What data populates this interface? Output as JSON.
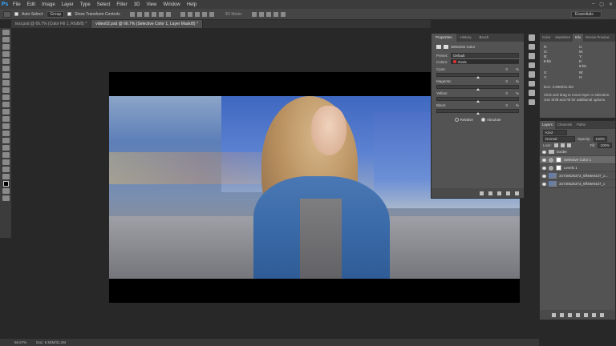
{
  "app": {
    "logo": "Ps"
  },
  "menu": [
    "File",
    "Edit",
    "Image",
    "Layer",
    "Type",
    "Select",
    "Filter",
    "3D",
    "View",
    "Window",
    "Help"
  ],
  "window_controls": [
    "–",
    "▢",
    "✕"
  ],
  "options_bar": {
    "auto_select_label": "Auto-Select:",
    "auto_select_value": "Group",
    "show_transform_label": "Show Transform Controls",
    "mode_label": "3D Mode:",
    "workspace": "Essentials"
  },
  "tabs": [
    {
      "label": "test.psd @ 66.7% (Color Fill 1, RGB/8) *",
      "active": false
    },
    {
      "label": "video02.psd @ 66.7% (Selective Color 1, Layer Mask/8) *",
      "active": true
    }
  ],
  "properties_panel": {
    "tabs": [
      "Properties",
      "History",
      "Brush"
    ],
    "title": "Selective Color",
    "preset_label": "Preset:",
    "preset_value": "Default",
    "colors_label": "Colors:",
    "colors_value": "Reds",
    "sliders": [
      {
        "label": "Cyan:",
        "value": "0",
        "unit": "%",
        "position": 0.5
      },
      {
        "label": "Magenta:",
        "value": "0",
        "unit": "%",
        "position": 0.5
      },
      {
        "label": "Yellow:",
        "value": "0",
        "unit": "%",
        "position": 0.5
      },
      {
        "label": "Black:",
        "value": "0",
        "unit": "%",
        "position": 0.5
      }
    ],
    "method_relative": "Relative",
    "method_absolute": "Absolute",
    "method_selected": "Absolute"
  },
  "info_panel": {
    "tabs": [
      "Color",
      "Swatches",
      "Info",
      "Device Preview"
    ],
    "left": [
      "R:",
      "G:",
      "B:",
      "8-bit"
    ],
    "right": [
      "C:",
      "M:",
      "Y:",
      "K:",
      "8-bit"
    ],
    "xy": [
      "X:",
      "Y:"
    ],
    "wh": [
      "W:",
      "H:"
    ],
    "doc": "Doc: 3.95M/31.2M",
    "hint": "Click and drag to move layer or selection. Use Shift and Alt for additional options."
  },
  "layers_panel": {
    "tabs": [
      "Layers",
      "Channels",
      "Paths"
    ],
    "filter_value": "Kind",
    "blend_mode": "Normal",
    "opacity_label": "Opacity:",
    "opacity_value": "100%",
    "lock_label": "Lock:",
    "fill_label": "Fill:",
    "fill_value": "100%",
    "layers": [
      {
        "name": "border",
        "kind": "group",
        "selected": false
      },
      {
        "name": "Selective Color 1",
        "kind": "adjustment",
        "selected": true
      },
      {
        "name": "Levels 1",
        "kind": "adjustment",
        "selected": false
      },
      {
        "name": "34730625373_6ff49e0437_o...",
        "kind": "pixel",
        "selected": false
      },
      {
        "name": "34730625373_6ff49e0437_o",
        "kind": "pixel",
        "selected": false
      }
    ]
  },
  "status": {
    "zoom": "66.67%",
    "doc": "Doc: 5.93M/31.2M"
  }
}
